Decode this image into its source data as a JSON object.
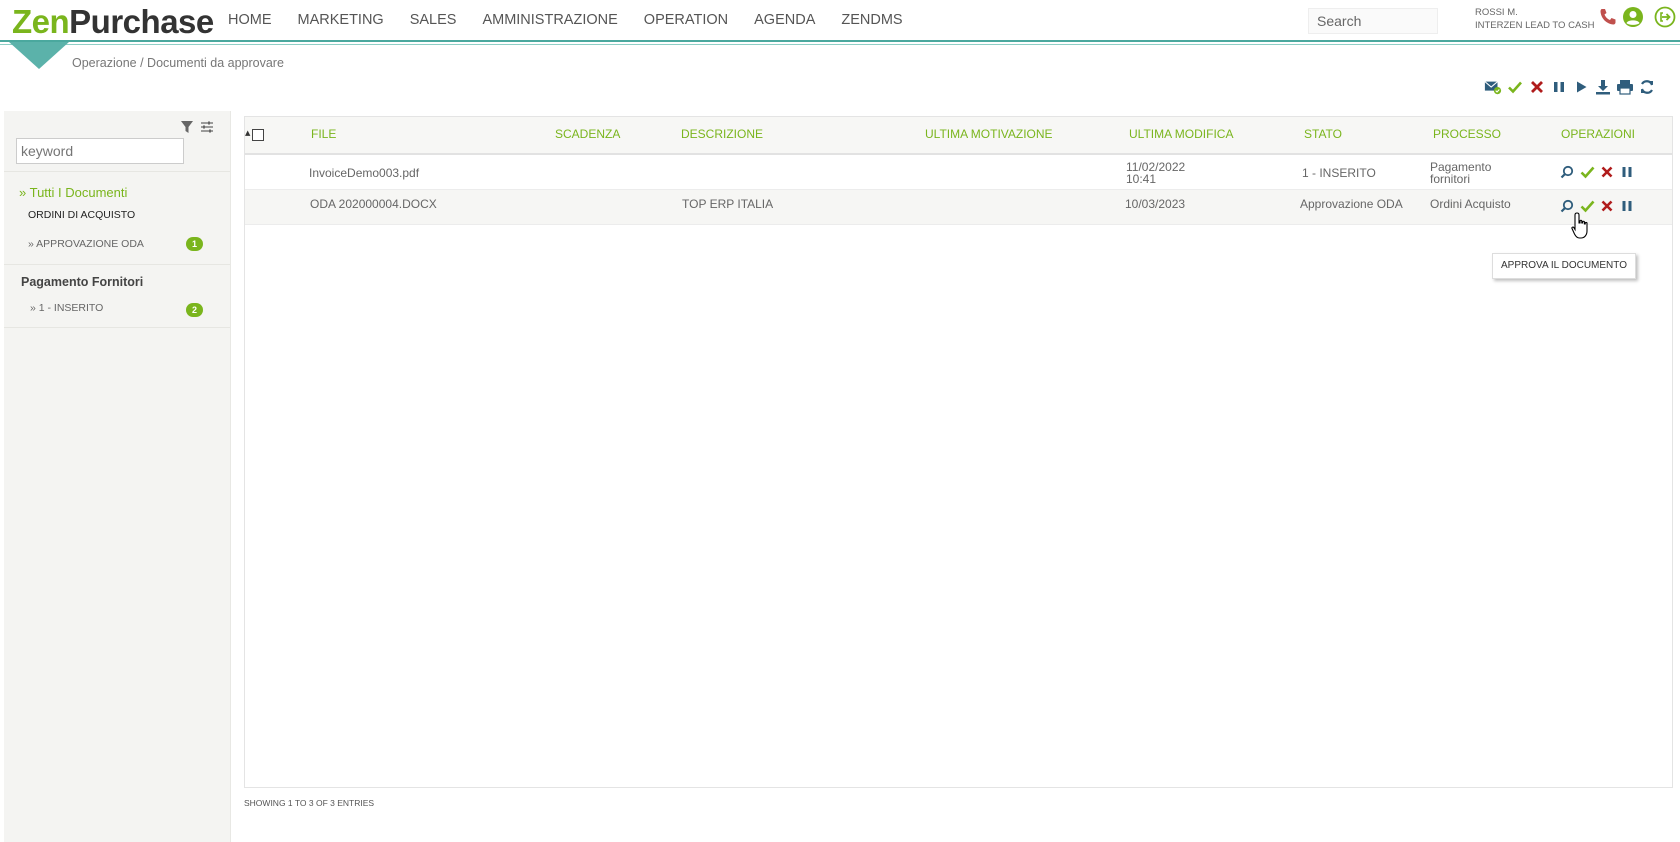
{
  "app": {
    "logo_part1": "Zen",
    "logo_part2": "Purchase"
  },
  "nav": [
    "HOME",
    "MARKETING",
    "SALES",
    "AMMINISTRAZIONE",
    "OPERATION",
    "AGENDA",
    "ZENDMS"
  ],
  "search": {
    "placeholder": "Search"
  },
  "user": {
    "name": "ROSSI M.",
    "company": "INTERZEN LEAD TO CASH"
  },
  "breadcrumb": "Operazione / Documenti da approvare",
  "sidebar": {
    "keyword_placeholder": "keyword",
    "all_docs": "» Tutti I Documenti",
    "group1": "ORDINI DI ACQUISTO",
    "group1_item": "» APPROVAZIONE ODA",
    "group1_count": "1",
    "group2": "Pagamento Fornitori",
    "group2_item": "» 1 - INSERITO",
    "group2_count": "2"
  },
  "table": {
    "columns": [
      "FILE",
      "SCADENZA",
      "DESCRIZIONE",
      "ULTIMA MOTIVAZIONE",
      "ULTIMA MODIFICA",
      "STATO",
      "PROCESSO",
      "OPERAZIONI"
    ],
    "rows": [
      {
        "file": "InvoiceDemo003.pdf",
        "scadenza": "",
        "descrizione": "",
        "motivazione": "",
        "modifica_date": "11/02/2022",
        "modifica_time": "10:41",
        "stato": "1 - INSERITO",
        "processo_l1": "Pagamento",
        "processo_l2": "fornitori"
      },
      {
        "file": "ODA 202000004.DOCX",
        "scadenza": "",
        "descrizione": "TOP ERP ITALIA",
        "motivazione": "",
        "modifica_date": "10/03/2023",
        "modifica_time": "",
        "stato": "Approvazione ODA",
        "processo_l1": "Ordini Acquisto",
        "processo_l2": ""
      }
    ]
  },
  "tooltip": "APPROVA IL DOCUMENTO",
  "footer": "SHOWING 1 TO 3 OF 3 ENTRIES",
  "colors": {
    "accent_green": "#7ab51d",
    "teal": "#4aa89e",
    "reject_red": "#b01c1c",
    "pause_blue": "#2f5d7c"
  }
}
